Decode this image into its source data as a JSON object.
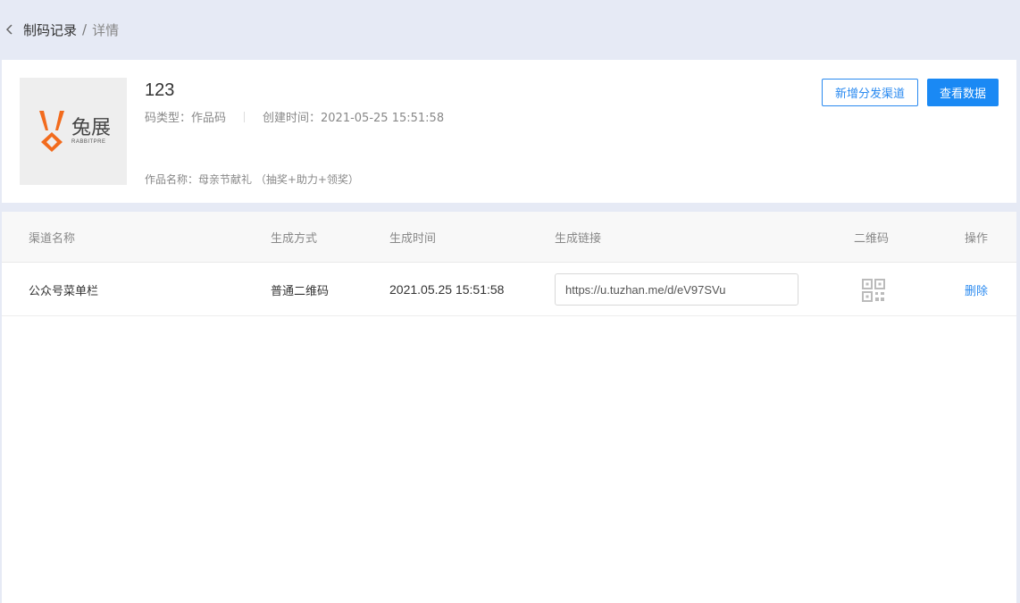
{
  "breadcrumb": {
    "parent": "制码记录",
    "separator": "/",
    "current": "详情"
  },
  "work": {
    "title": "123",
    "code_type": "码类型：作品码",
    "created": "创建时间：2021-05-25 15:51:58",
    "name": "作品名称：母亲节献礼 （抽奖+助力+领奖）",
    "logo_text": "兔展",
    "logo_subtext": "RABBITPRE"
  },
  "actions": {
    "add_channel": "新增分发渠道",
    "view_data": "查看数据"
  },
  "table": {
    "headers": {
      "name": "渠道名称",
      "mode": "生成方式",
      "time": "生成时间",
      "link": "生成链接",
      "qr": "二维码",
      "op": "操作"
    },
    "rows": [
      {
        "name": "公众号菜单栏",
        "mode": "普通二维码",
        "time": "2021.05.25 15:51:58",
        "link": "https://u.tuzhan.me/d/eV97SVu",
        "op": "删除"
      }
    ]
  },
  "colors": {
    "accent": "#1a89f4",
    "logo_orange": "#f26b1d",
    "page_bg": "#e6eaf5"
  },
  "icons": {
    "back": "chevron-left-icon",
    "qr": "qr-code-icon"
  }
}
